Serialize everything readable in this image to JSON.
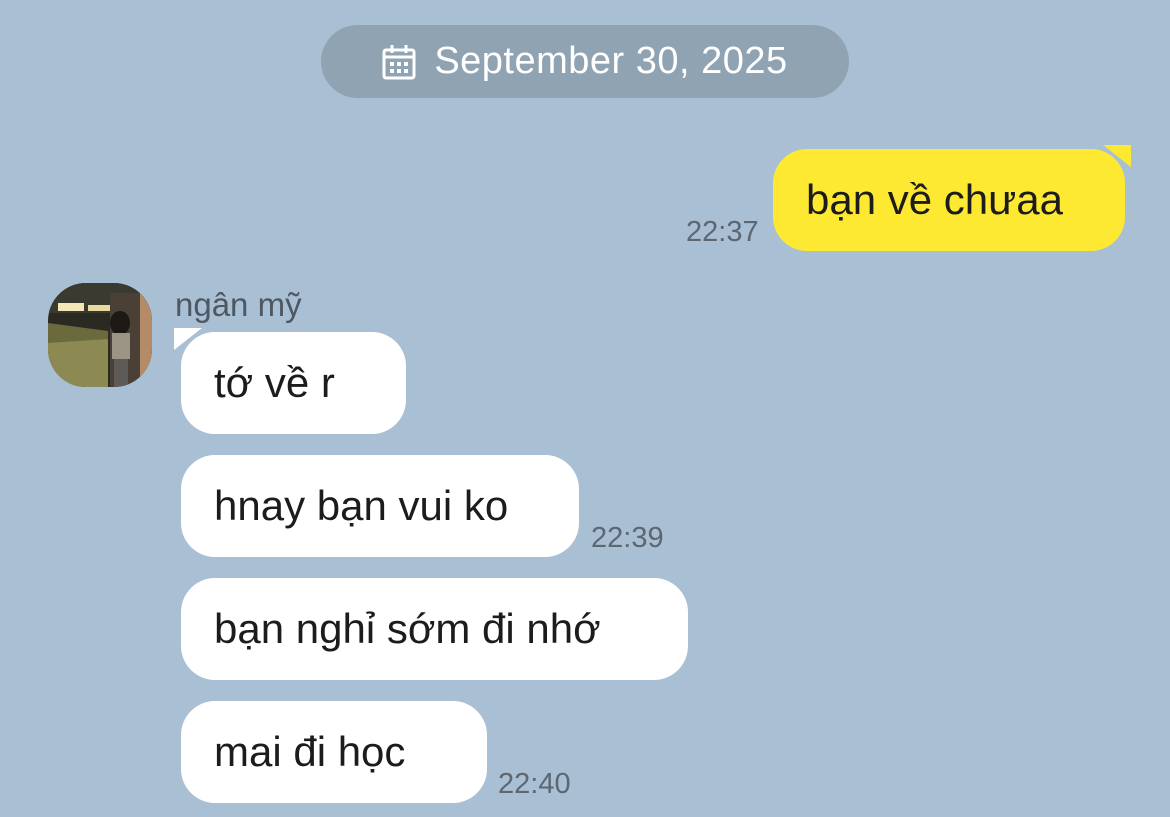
{
  "date_header": {
    "icon": "calendar-icon",
    "text": "September 30, 2025"
  },
  "messages": [
    {
      "side": "sent",
      "text": "bạn về chưaa",
      "time": "22:37"
    },
    {
      "side": "received",
      "sender": "ngân mỹ",
      "text": "tớ về r",
      "time": ""
    },
    {
      "side": "received",
      "text": "hnay bạn vui ko",
      "time": "22:39"
    },
    {
      "side": "received",
      "text": "bạn nghỉ sớm đi nhớ",
      "time": ""
    },
    {
      "side": "received",
      "text": "mai đi học",
      "time": "22:40"
    }
  ],
  "colors": {
    "background": "#a9bfd3",
    "sent_bubble": "#fee932",
    "received_bubble": "#ffffff",
    "date_pill": "#8fa3b3",
    "timestamp": "#5d6772"
  }
}
